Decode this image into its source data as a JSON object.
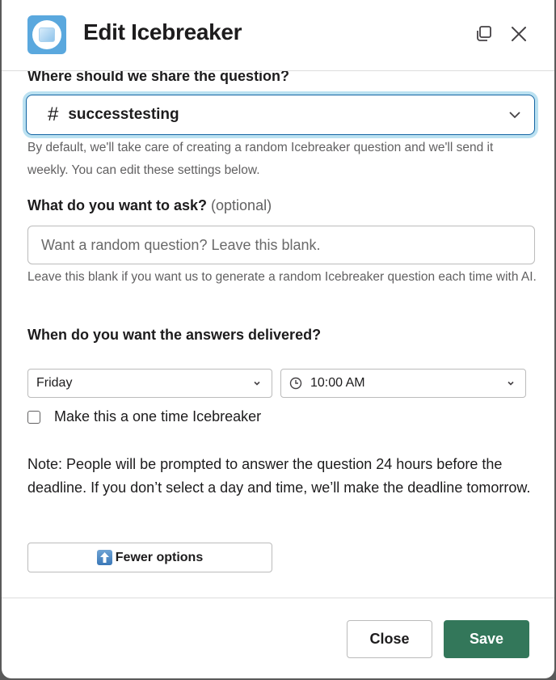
{
  "header": {
    "title": "Edit Icebreaker",
    "app_icon": "ice-cube-icon",
    "popout_icon": "popout-icon",
    "close_icon": "close-icon"
  },
  "channel": {
    "label": "Where should we share the question?",
    "icon": "hash-icon",
    "selected": "successtesting",
    "hint": "By default, we'll take care of creating a random Icebreaker question and we'll send it weekly. You can edit these settings below."
  },
  "question": {
    "label": "What do you want to ask?",
    "optional_label": "(optional)",
    "value": "",
    "placeholder": "Want a random question? Leave this blank.",
    "hint": "Leave this blank if you want us to generate a random Icebreaker question each time with AI."
  },
  "delivery": {
    "label": "When do you want the answers delivered?",
    "day_selected": "Friday",
    "time_selected": "10:00 AM",
    "time_icon": "clock-icon",
    "one_time_label": "Make this a one time Icebreaker",
    "one_time_checked": false
  },
  "note": "Note: People will be prompted to answer the question 24 hours before the deadline. If you don’t select a day and time, we’ll make the deadline tomorrow.",
  "fewer_options": {
    "label": "Fewer options",
    "icon": "up-arrow-icon"
  },
  "footer": {
    "close_label": "Close",
    "save_label": "Save"
  },
  "colors": {
    "primary": "#33775a",
    "focus": "#1264a3",
    "app_icon_bg": "#5aa8de"
  }
}
